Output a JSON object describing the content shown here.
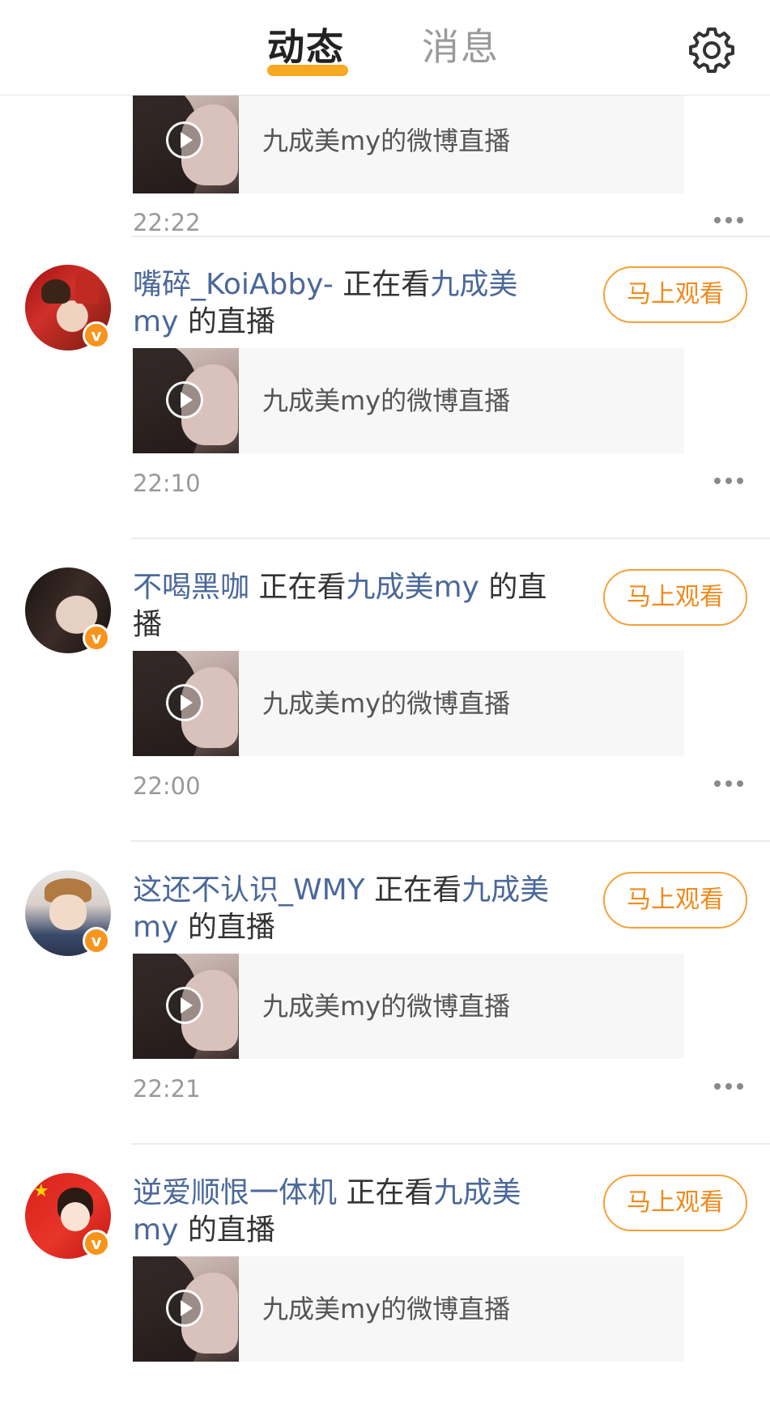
{
  "header": {
    "tab_active": "动态",
    "tab_inactive": "消息",
    "accent_color": "#f7a922",
    "settings_icon": "gear-icon"
  },
  "feed": {
    "watch_label": "马上观看",
    "verified_mark": "v",
    "action_text": "正在看",
    "of_text": "的直播",
    "of_text_short": "的",
    "of_text_tail": "直播",
    "link_color": "#4a6899",
    "first_item": {
      "media_title": "九成美my的微博直播",
      "time": "22:22"
    },
    "items": [
      {
        "user": "嘴碎_KoiAbby-",
        "streamer": "九成美my",
        "media_title": "九成美my的微博直播",
        "time": "22:10"
      },
      {
        "user": "不喝黑咖",
        "streamer": "九成美my",
        "media_title": "九成美my的微博直播",
        "time": "22:00"
      },
      {
        "user": "这还不认识_WMY",
        "streamer": "九成美my",
        "media_title": "九成美my的微博直播",
        "time": "22:21"
      },
      {
        "user": "逆爱顺恨一体机",
        "streamer": "九成美my",
        "media_title": "九成美my的微博直播",
        "time": ""
      }
    ]
  }
}
